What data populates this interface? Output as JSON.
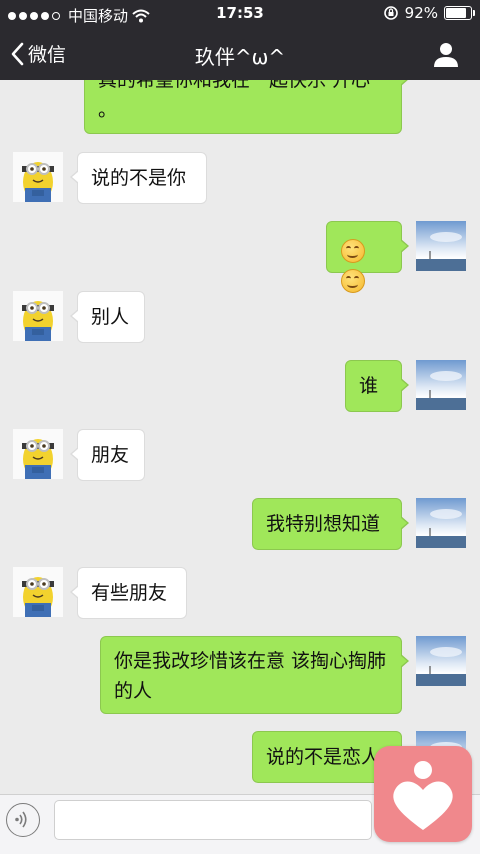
{
  "status_bar": {
    "carrier": "中国移动",
    "time": "17:53",
    "battery_percent": "92%",
    "battery_level": 0.92
  },
  "nav": {
    "back_label": "微信",
    "title": "玖伴^ω^"
  },
  "messages": [
    {
      "side": "out",
      "text": "真的希望你和我在一起快乐 开心 。"
    },
    {
      "side": "in",
      "text": "说的不是你"
    },
    {
      "side": "out",
      "text": "",
      "emoji": [
        "smile-emoji",
        "smile-emoji"
      ]
    },
    {
      "side": "in",
      "text": "别人"
    },
    {
      "side": "out",
      "text": "谁"
    },
    {
      "side": "in",
      "text": "朋友"
    },
    {
      "side": "out",
      "text": "我特别想知道"
    },
    {
      "side": "in",
      "text": "有些朋友"
    },
    {
      "side": "out",
      "text": "你是我改珍惜该在意 该掏心掏肺的人"
    },
    {
      "side": "out",
      "text": "说的不是恋人"
    }
  ],
  "input": {
    "value": ""
  },
  "colors": {
    "bar_background": "#2b2a2f",
    "chat_background": "#ebebeb",
    "outgoing_bubble": "#a0e75a",
    "incoming_bubble": "#ffffff",
    "logo_background": "#f0888c"
  }
}
